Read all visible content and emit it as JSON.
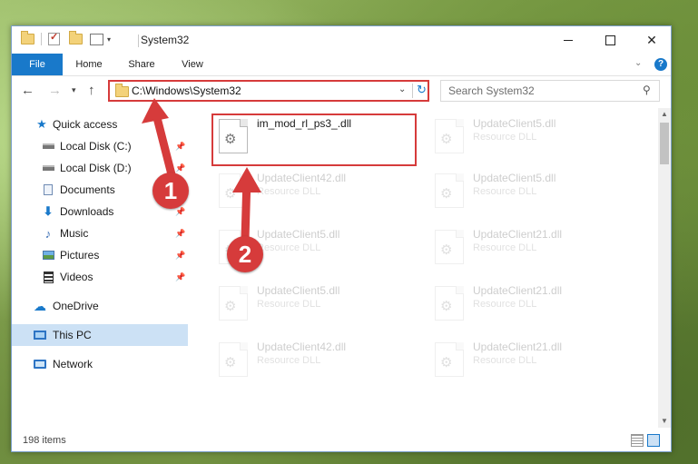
{
  "window": {
    "title": "System32"
  },
  "ribbon": {
    "tabs": [
      "File",
      "Home",
      "Share",
      "View"
    ],
    "help": "?"
  },
  "navigation": {
    "address": "C:\\Windows\\System32",
    "search_placeholder": "Search System32"
  },
  "sidebar": {
    "items": [
      {
        "label": "Quick access",
        "icon": "star-icon",
        "pinned": false
      },
      {
        "label": "Local Disk (C:)",
        "icon": "drive-icon",
        "pinned": true
      },
      {
        "label": "Local Disk (D:)",
        "icon": "drive-icon",
        "pinned": true
      },
      {
        "label": "Documents",
        "icon": "document-icon",
        "pinned": true
      },
      {
        "label": "Downloads",
        "icon": "download-icon",
        "pinned": true
      },
      {
        "label": "Music",
        "icon": "music-icon",
        "pinned": true
      },
      {
        "label": "Pictures",
        "icon": "pictures-icon",
        "pinned": true
      },
      {
        "label": "Videos",
        "icon": "video-icon",
        "pinned": true
      },
      {
        "label": "OneDrive",
        "icon": "cloud-icon",
        "pinned": false
      },
      {
        "label": "This PC",
        "icon": "computer-icon",
        "pinned": false,
        "selected": true
      },
      {
        "label": "Network",
        "icon": "network-icon",
        "pinned": false
      }
    ]
  },
  "files": {
    "highlighted": {
      "name": "im_mod_rl_ps3_.dll",
      "type": ""
    },
    "left_column": [
      {
        "name": "UpdateClient42.dll",
        "type": "Resource DLL"
      },
      {
        "name": "UpdateClient5.dll",
        "type": "Resource DLL"
      },
      {
        "name": "UpdateClient5.dll",
        "type": "Resource DLL"
      },
      {
        "name": "UpdateClient42.dll",
        "type": "Resource DLL"
      }
    ],
    "right_column": [
      {
        "name": "UpdateClient5.dll",
        "type": "Resource DLL"
      },
      {
        "name": "UpdateClient5.dll",
        "type": "Resource DLL"
      },
      {
        "name": "UpdateClient21.dll",
        "type": "Resource DLL"
      },
      {
        "name": "UpdateClient21.dll",
        "type": "Resource DLL"
      },
      {
        "name": "UpdateClient21.dll",
        "type": "Resource DLL"
      }
    ]
  },
  "status": {
    "item_count": "198 items"
  },
  "callouts": {
    "one": "1",
    "two": "2"
  },
  "colors": {
    "accent": "#1979ca",
    "highlight": "#d63b3b",
    "selected_bg": "#cce1f5"
  }
}
